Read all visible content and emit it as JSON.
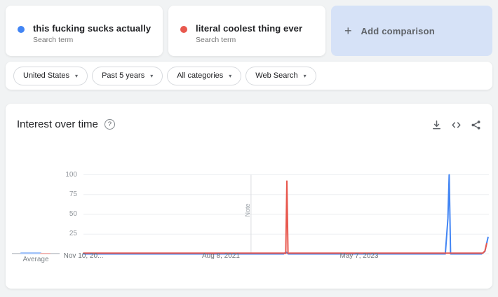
{
  "header": {
    "terms": [
      {
        "label": "this fucking sucks actually",
        "sublabel": "Search term",
        "color": "#4285f4"
      },
      {
        "label": "literal coolest thing ever",
        "sublabel": "Search term",
        "color": "#e8584e"
      }
    ],
    "add_comparison": {
      "plus_glyph": "+",
      "label": "Add comparison",
      "bg": "#d6e2f7"
    }
  },
  "filters": {
    "caret_glyph": "▾",
    "items": [
      {
        "label": "United States"
      },
      {
        "label": "Past 5 years"
      },
      {
        "label": "All categories"
      },
      {
        "label": "Web Search"
      }
    ]
  },
  "chart_card": {
    "title": "Interest over time",
    "help_glyph": "?",
    "action_icons": [
      "download-icon",
      "embed-icon",
      "share-icon"
    ],
    "average_label": "Average",
    "average_marker": {
      "base_color": "#cdd1d5",
      "term1_color": "#aecbfa",
      "term2_color": "#f2b8b5"
    }
  },
  "chart_data": {
    "type": "line",
    "title": "Interest over time",
    "ylim": [
      0,
      100
    ],
    "yticks": [
      100,
      75,
      50,
      25
    ],
    "grid": true,
    "xticks": [
      {
        "label": "Nov 10, 20...",
        "pos": 0
      },
      {
        "label": "Aug 8, 2021",
        "pos": 0.339
      },
      {
        "label": "May 7, 2023",
        "pos": 0.68
      }
    ],
    "note_line": {
      "pos": 0.4134,
      "label": "Note"
    },
    "gridline_color": "#edeff2",
    "note_line_color": "#dadce0",
    "series": [
      {
        "name": "this fucking sucks actually",
        "color": "#4285f4",
        "average": 1,
        "points": [
          [
            0,
            0
          ],
          [
            0.08,
            0
          ],
          [
            0.2,
            0
          ],
          [
            0.3,
            0
          ],
          [
            0.4,
            0
          ],
          [
            0.494,
            0
          ],
          [
            0.4995,
            2.5
          ],
          [
            0.505,
            0
          ],
          [
            0.6,
            0
          ],
          [
            0.7,
            0
          ],
          [
            0.8,
            0
          ],
          [
            0.8925,
            0
          ],
          [
            0.899,
            45
          ],
          [
            0.902,
            100
          ],
          [
            0.9055,
            0
          ],
          [
            0.94,
            0
          ],
          [
            0.982,
            0
          ],
          [
            0.99,
            3
          ],
          [
            0.998,
            21
          ]
        ]
      },
      {
        "name": "literal coolest thing ever",
        "color": "#e8584e",
        "average": 1,
        "points": [
          [
            0,
            1
          ],
          [
            0.1,
            1
          ],
          [
            0.2,
            1
          ],
          [
            0.3,
            1
          ],
          [
            0.4,
            1
          ],
          [
            0.4955,
            1
          ],
          [
            0.499,
            0.5
          ],
          [
            0.5017,
            92
          ],
          [
            0.5045,
            0.5
          ],
          [
            0.508,
            1
          ],
          [
            0.6,
            1
          ],
          [
            0.7,
            1
          ],
          [
            0.8,
            1
          ],
          [
            0.9,
            1
          ],
          [
            0.975,
            1
          ],
          [
            0.985,
            1
          ],
          [
            0.9905,
            4
          ],
          [
            0.9945,
            13
          ]
        ]
      }
    ]
  }
}
